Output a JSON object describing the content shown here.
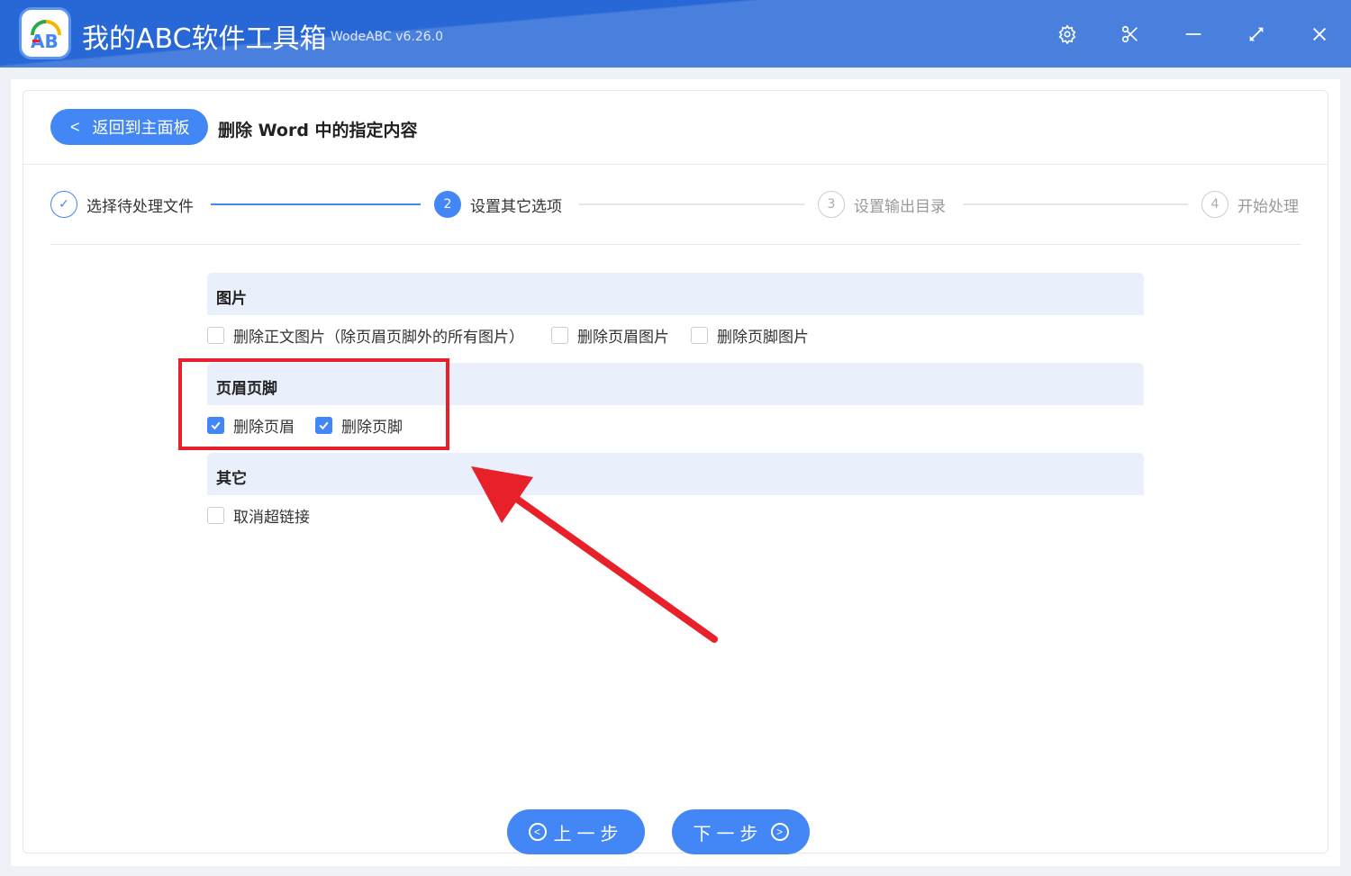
{
  "app": {
    "title": "我的ABC软件工具箱",
    "version": "WodeABC v6.26.0",
    "logo_text": "AB"
  },
  "header": {
    "back_label": "返回到主面板",
    "page_title": "删除 Word 中的指定内容"
  },
  "steps": [
    {
      "num": "✓",
      "label": "选择待处理文件",
      "state": "done"
    },
    {
      "num": "2",
      "label": "设置其它选项",
      "state": "active"
    },
    {
      "num": "3",
      "label": "设置输出目录",
      "state": "todo"
    },
    {
      "num": "4",
      "label": "开始处理",
      "state": "todo"
    }
  ],
  "sections": [
    {
      "title": "图片",
      "options": [
        {
          "label": "删除正文图片（除页眉页脚外的所有图片）",
          "checked": false
        },
        {
          "label": "删除页眉图片",
          "checked": false
        },
        {
          "label": "删除页脚图片",
          "checked": false
        }
      ]
    },
    {
      "title": "页眉页脚",
      "options": [
        {
          "label": "删除页眉",
          "checked": true
        },
        {
          "label": "删除页脚",
          "checked": true
        }
      ]
    },
    {
      "title": "其它",
      "options": [
        {
          "label": "取消超链接",
          "checked": false
        }
      ]
    }
  ],
  "footer": {
    "prev_label": "上一步",
    "next_label": "下一步"
  },
  "colors": {
    "accent": "#4287f5",
    "annotation": "#e8202a"
  }
}
